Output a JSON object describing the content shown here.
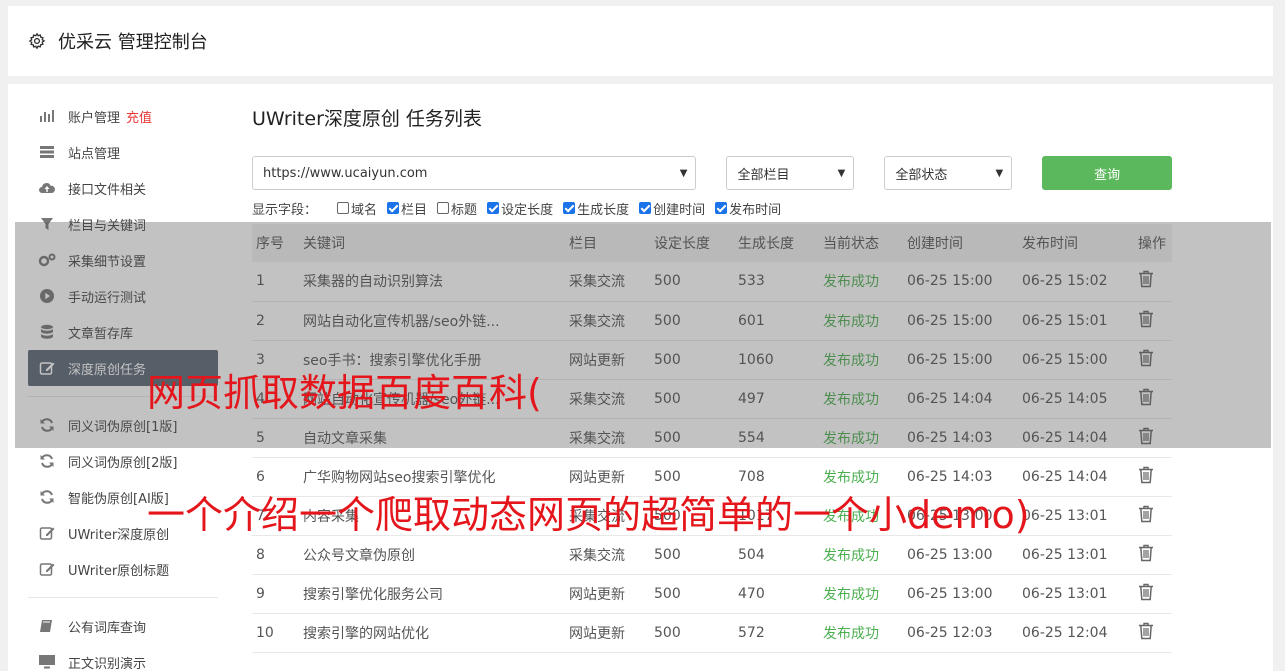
{
  "app": {
    "title": "优采云 管理控制台"
  },
  "sidebar": {
    "groups": [
      [
        {
          "label": "账户管理",
          "extra": "充值",
          "icon": "bar-chart-icon"
        },
        {
          "label": "站点管理",
          "icon": "server-icon"
        },
        {
          "label": "接口文件相关",
          "icon": "cloud-upload-icon"
        },
        {
          "label": "栏目与关键词",
          "icon": "filter-icon"
        },
        {
          "label": "采集细节设置",
          "icon": "gears-icon"
        },
        {
          "label": "手动运行测试",
          "icon": "play-circle-icon"
        },
        {
          "label": "文章暂存库",
          "icon": "database-icon"
        },
        {
          "label": "深度原创任务",
          "icon": "edit-icon",
          "active": true
        }
      ],
      [
        {
          "label": "同义词伪原创[1版]",
          "icon": "refresh-icon"
        },
        {
          "label": "同义词伪原创[2版]",
          "icon": "refresh-icon"
        },
        {
          "label": "智能伪原创[AI版]",
          "icon": "refresh-icon"
        },
        {
          "label": "UWriter深度原创",
          "icon": "edit-icon"
        },
        {
          "label": "UWriter原创标题",
          "icon": "edit-icon"
        }
      ],
      [
        {
          "label": "公有词库查询",
          "icon": "book-icon"
        },
        {
          "label": "正文识别演示",
          "icon": "monitor-icon"
        }
      ]
    ]
  },
  "main": {
    "title": "UWriter深度原创 任务列表",
    "filters": {
      "site": "https://www.ucaiyun.com",
      "column": "全部栏目",
      "status": "全部状态",
      "query_label": "查询"
    },
    "fields_label": "显示字段：",
    "fields": [
      {
        "label": "域名",
        "checked": false
      },
      {
        "label": "栏目",
        "checked": true
      },
      {
        "label": "标题",
        "checked": false
      },
      {
        "label": "设定长度",
        "checked": true
      },
      {
        "label": "生成长度",
        "checked": true
      },
      {
        "label": "创建时间",
        "checked": true
      },
      {
        "label": "发布时间",
        "checked": true
      }
    ],
    "table": {
      "headers": [
        "序号",
        "关键词",
        "栏目",
        "设定长度",
        "生成长度",
        "当前状态",
        "创建时间",
        "发布时间",
        "操作"
      ],
      "rows": [
        [
          "1",
          "采集器的自动识别算法",
          "采集交流",
          "500",
          "533",
          "发布成功",
          "06-25 15:00",
          "06-25 15:02"
        ],
        [
          "2",
          "网站自动化宣传机器/seo外链...",
          "采集交流",
          "500",
          "601",
          "发布成功",
          "06-25 15:00",
          "06-25 15:01"
        ],
        [
          "3",
          "seo手书：搜索引擎优化手册",
          "网站更新",
          "500",
          "1060",
          "发布成功",
          "06-25 15:00",
          "06-25 15:00"
        ],
        [
          "4",
          "网站自动化宣传机器/seo外链...",
          "采集交流",
          "500",
          "497",
          "发布成功",
          "06-25 14:04",
          "06-25 14:05"
        ],
        [
          "5",
          "自动文章采集",
          "采集交流",
          "500",
          "554",
          "发布成功",
          "06-25 14:03",
          "06-25 14:04"
        ],
        [
          "6",
          "广华购物网站seo搜索引擎优化",
          "网站更新",
          "500",
          "708",
          "发布成功",
          "06-25 14:03",
          "06-25 14:04"
        ],
        [
          "7",
          "内容采集",
          "采集交流",
          "500",
          "1017",
          "发布成功",
          "06-25 13:00",
          "06-25 13:01"
        ],
        [
          "8",
          "公众号文章伪原创",
          "采集交流",
          "500",
          "504",
          "发布成功",
          "06-25 13:00",
          "06-25 13:01"
        ],
        [
          "9",
          "搜索引擎优化服务公司",
          "网站更新",
          "500",
          "470",
          "发布成功",
          "06-25 13:00",
          "06-25 13:01"
        ],
        [
          "10",
          "搜索引擎的网站优化",
          "网站更新",
          "500",
          "572",
          "发布成功",
          "06-25 12:03",
          "06-25 12:04"
        ]
      ]
    }
  },
  "overlay": {
    "line1": "网页抓取数据百度百科(",
    "line2": "一个介绍一个爬取动态网页的超简单的一个小demo)"
  }
}
